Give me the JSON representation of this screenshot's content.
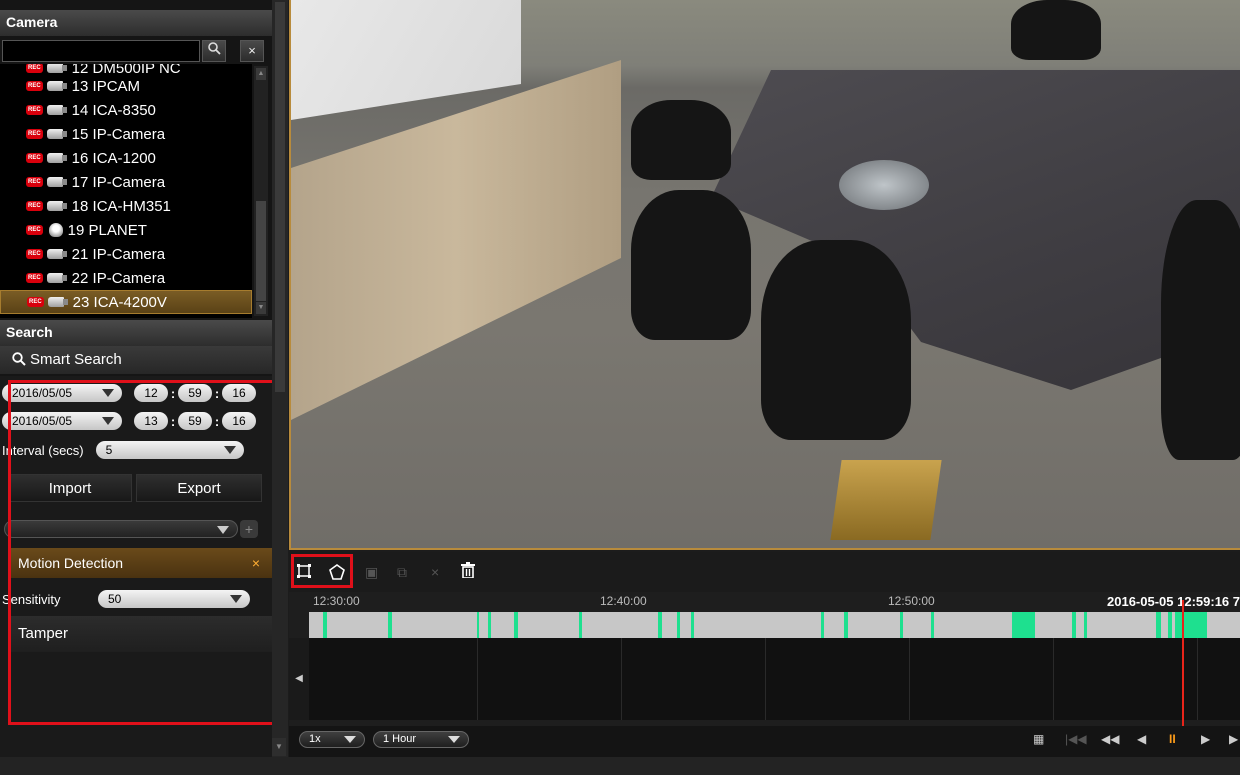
{
  "camera_panel": {
    "title": "Camera",
    "search_placeholder": "",
    "search_icon": "search-icon",
    "clear_icon": "close-icon",
    "clear_glyph": "×",
    "search_glyph": "Q",
    "items": [
      {
        "label": "12 DM500IP NC",
        "rec": true,
        "icon": "bullet-camera-icon"
      },
      {
        "label": "13 IPCAM",
        "rec": true,
        "icon": "bullet-camera-icon"
      },
      {
        "label": "14 ICA-8350",
        "rec": true,
        "icon": "bullet-camera-icon"
      },
      {
        "label": "15 IP-Camera",
        "rec": true,
        "icon": "bullet-camera-icon"
      },
      {
        "label": "16 ICA-1200",
        "rec": true,
        "icon": "bullet-camera-icon"
      },
      {
        "label": "17 IP-Camera",
        "rec": true,
        "icon": "bullet-camera-icon"
      },
      {
        "label": "18 ICA-HM351",
        "rec": true,
        "icon": "bullet-camera-icon"
      },
      {
        "label": "19 PLANET",
        "rec": true,
        "icon": "dome-camera-icon"
      },
      {
        "label": "21 IP-Camera",
        "rec": true,
        "icon": "bullet-camera-icon"
      },
      {
        "label": "22 IP-Camera",
        "rec": true,
        "icon": "bullet-camera-icon"
      },
      {
        "label": "23 ICA-4200V",
        "rec": true,
        "icon": "bullet-camera-icon",
        "selected": true
      }
    ],
    "rec_badge": "REC"
  },
  "search_panel": {
    "title": "Search",
    "smart_search_label": "Smart Search",
    "start": {
      "date": "2016/05/05",
      "hh": "12",
      "mm": "59",
      "ss": "16"
    },
    "end": {
      "date": "2016/05/05",
      "hh": "13",
      "mm": "59",
      "ss": "16"
    },
    "time_separator": ":",
    "interval_label": "Interval (secs)",
    "interval_value": "5",
    "import_label": "Import",
    "export_label": "Export",
    "profile_value": "",
    "add_glyph": "+",
    "motion_label": "Motion Detection",
    "motion_remove_glyph": "×",
    "sensitivity_label": "Sensitivity",
    "sensitivity_value": "50",
    "tamper_label": "Tamper"
  },
  "video_tools": {
    "rect_glyph": "⌑",
    "poly_glyph": "⬠",
    "copy_glyph": "▣",
    "paste_glyph": "⧉",
    "delete_glyph": "×",
    "trash_glyph": "🗑"
  },
  "timeline": {
    "ticks": [
      "12:30:00",
      "12:40:00",
      "12:50:00"
    ],
    "current_time": "2016-05-05 12:59:16 7",
    "left_arrow": "◀",
    "motion_segments_percent": [
      [
        1.5,
        0.4
      ],
      [
        8.5,
        0.4
      ],
      [
        18.0,
        0.3
      ],
      [
        19.2,
        0.3
      ],
      [
        22.0,
        0.4
      ],
      [
        29.0,
        0.3
      ],
      [
        37.5,
        0.4
      ],
      [
        39.5,
        0.3
      ],
      [
        41.0,
        0.4
      ],
      [
        55.0,
        0.3
      ],
      [
        57.5,
        0.4
      ],
      [
        63.5,
        0.3
      ],
      [
        66.8,
        0.3
      ],
      [
        75.5,
        2.5
      ],
      [
        82.0,
        0.4
      ],
      [
        83.2,
        0.4
      ],
      [
        91.0,
        0.5
      ],
      [
        92.3,
        0.4
      ],
      [
        93.0,
        3.5
      ]
    ],
    "playhead_percent": 93.8
  },
  "bottom_bar": {
    "speed_value": "1x",
    "range_value": "1 Hour",
    "calendar_glyph": "▦",
    "first_glyph": "|◀◀",
    "rewind_glyph": "◀◀",
    "prev_glyph": "◀",
    "pause_glyph": "II",
    "next_glyph": "▶",
    "last_glyph": "▶"
  },
  "colors": {
    "accent": "#b88b3c",
    "motion": "#1ee08f",
    "highlight": "#e0101a",
    "rec": "#d9000c"
  }
}
